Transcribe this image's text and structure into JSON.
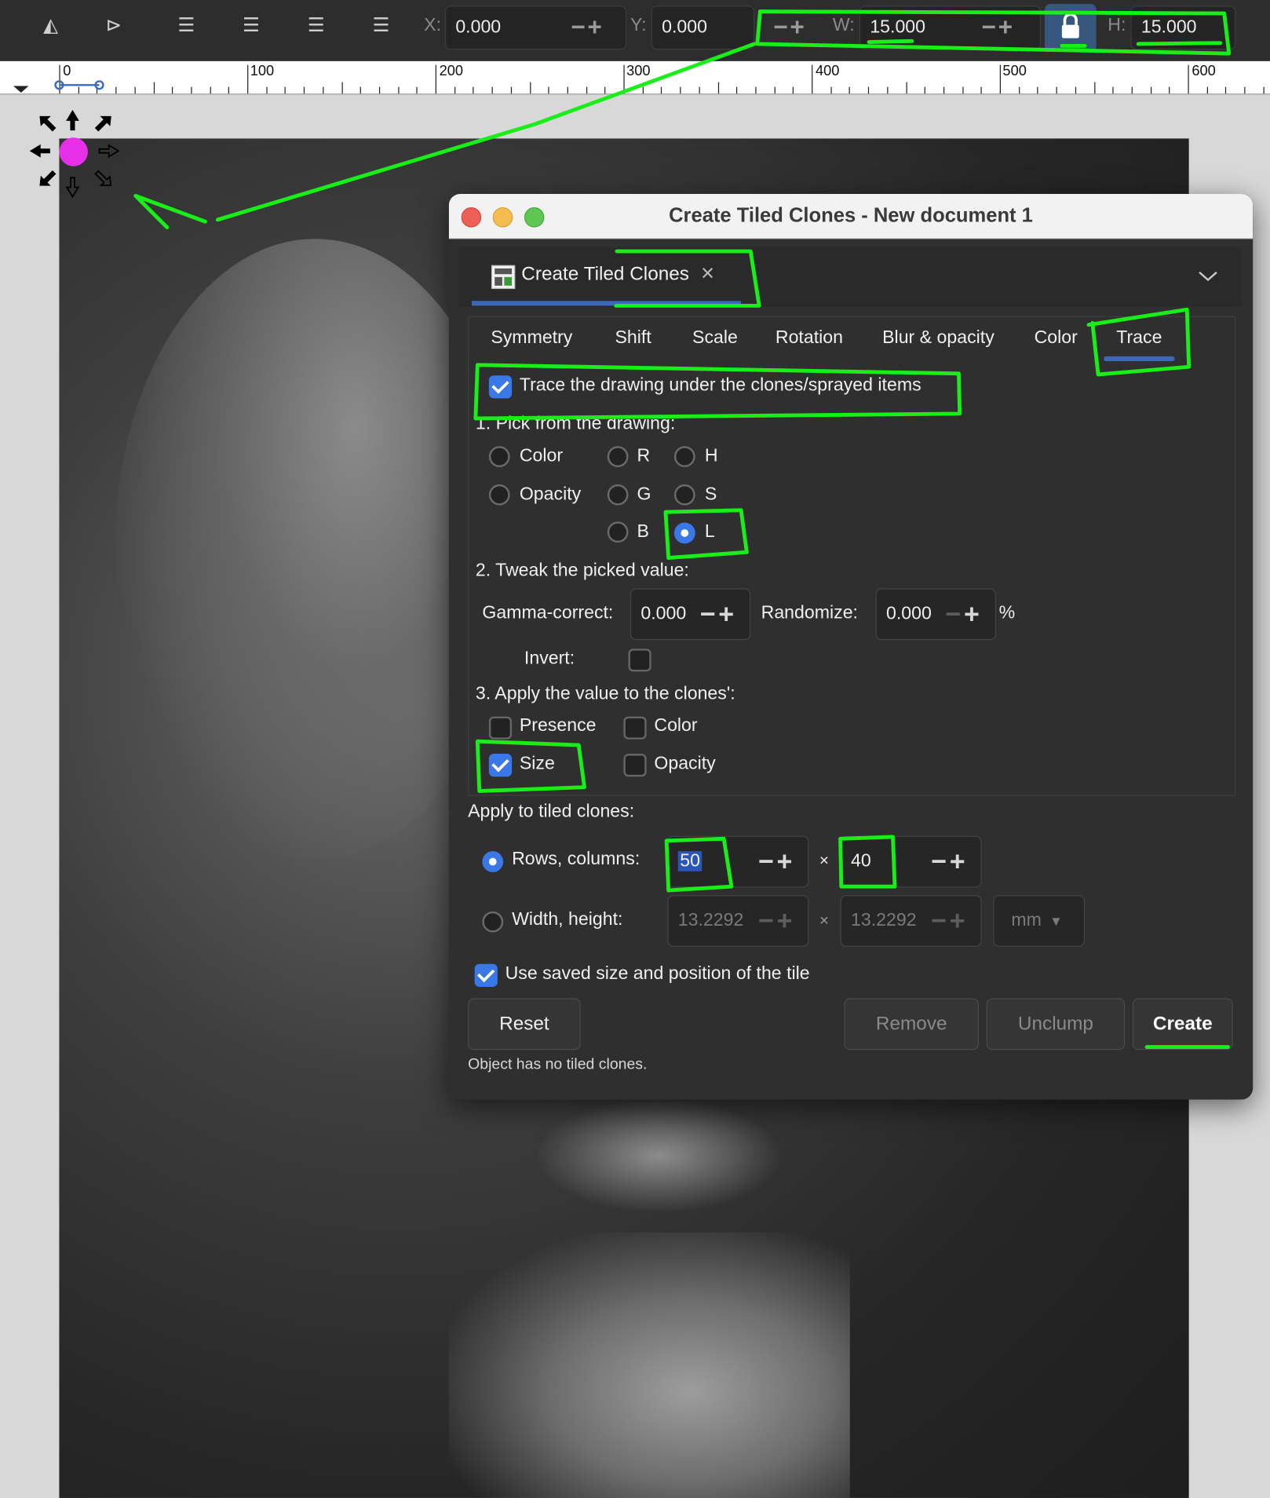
{
  "toolbar": {
    "x_label": "X:",
    "x_value": "0.000",
    "y_label": "Y:",
    "y_value": "0.000",
    "w_label": "W:",
    "w_value": "15.000",
    "h_label": "H:",
    "h_value": "15.000",
    "icons": [
      "flip-horizontal-icon",
      "flip-vertical-icon",
      "raise-to-top-icon",
      "raise-icon",
      "lower-icon",
      "lower-to-bottom-icon",
      "lock-icon"
    ]
  },
  "ruler": {
    "labels": [
      "0",
      "100",
      "200",
      "300",
      "400",
      "500",
      "600"
    ]
  },
  "dialog": {
    "window_title": "Create Tiled Clones - New document 1",
    "doc_tab_label": "Create Tiled Clones",
    "tabs": [
      "Symmetry",
      "Shift",
      "Scale",
      "Rotation",
      "Blur & opacity",
      "Color",
      "Trace"
    ],
    "active_tab": "Trace",
    "trace_checkbox_label": "Trace the drawing under the clones/sprayed items",
    "trace_checked": true,
    "pick_heading": "1. Pick from the drawing:",
    "pick_options": {
      "color": "Color",
      "opacity": "Opacity",
      "r": "R",
      "g": "G",
      "b": "B",
      "h": "H",
      "s": "S",
      "l": "L"
    },
    "pick_selected": "L",
    "tweak_heading": "2. Tweak the picked value:",
    "gamma_label": "Gamma-correct:",
    "gamma_value": "0.000",
    "randomize_label": "Randomize:",
    "randomize_value": "0.000",
    "percent": "%",
    "invert_label": "Invert:",
    "invert_checked": false,
    "apply_heading": "3. Apply the value to the clones':",
    "apply_options": {
      "presence": "Presence",
      "color": "Color",
      "size": "Size",
      "opacity": "Opacity"
    },
    "apply_size_checked": true,
    "apply_tiled_heading": "Apply to tiled clones:",
    "rows_columns_label": "Rows, columns:",
    "rows_value": "50",
    "columns_value": "40",
    "times": "×",
    "width_height_label": "Width, height:",
    "width_value": "13.2292",
    "height_value": "13.2292",
    "unit": "mm",
    "use_saved_label": "Use saved size and position of the tile",
    "use_saved_checked": true,
    "buttons": {
      "reset": "Reset",
      "remove": "Remove",
      "unclump": "Unclump",
      "create": "Create"
    },
    "status": "Object has no tiled clones."
  },
  "colors": {
    "annotation_green": "#19ee19",
    "accent_blue": "#3b78e7",
    "handle_dot": "#e72fe7"
  }
}
